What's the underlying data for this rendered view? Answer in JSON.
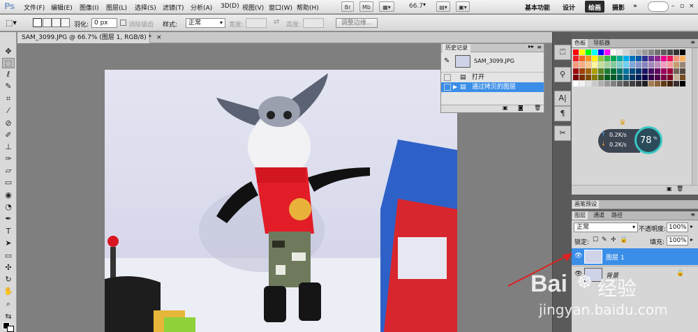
{
  "menubar": {
    "logo": "Ps",
    "items": [
      "文件(F)",
      "编辑(E)",
      "图像(I)",
      "图层(L)",
      "选择(S)",
      "滤镜(T)",
      "分析(A)",
      "3D(D)",
      "视图(V)",
      "窗口(W)",
      "帮助(H)"
    ],
    "app_buttons": [
      "Br",
      "Mb"
    ],
    "zoom": "66.7",
    "workspaces": [
      "基本功能",
      "设计",
      "绘画",
      "摄影"
    ],
    "active_workspace": "绘画",
    "more": "»"
  },
  "options": {
    "feather_label": "羽化:",
    "feather_value": "0 px",
    "antialias_label": "消除锯齿",
    "style_label": "样式:",
    "style_value": "正常",
    "width_label": "宽度:",
    "height_label": "高度:",
    "refine_button": "调整边缘..."
  },
  "document": {
    "tab_title": "SAM_3099.JPG @ 66.7% (图层 1, RGB/8) *",
    "close": "×"
  },
  "history": {
    "tab": "历史记录",
    "snapshot": "SAM_3099.JPG",
    "items": [
      {
        "label": "打开",
        "selected": false
      },
      {
        "label": "通过拷贝的图层",
        "selected": true
      }
    ]
  },
  "swatches": {
    "tabs": [
      "色板",
      "导航器"
    ],
    "colors": [
      "#ff0000",
      "#ffff00",
      "#00ff00",
      "#00ffff",
      "#0000ff",
      "#ff00ff",
      "#ffffff",
      "#ebebeb",
      "#d6d6d6",
      "#c2c2c2",
      "#adadad",
      "#999999",
      "#858585",
      "#707070",
      "#5c5c5c",
      "#474747",
      "#333333",
      "#000000",
      "#ee1d24",
      "#f26522",
      "#f7941d",
      "#fff200",
      "#8dc63f",
      "#39b54a",
      "#00a651",
      "#00a99d",
      "#00aeef",
      "#0072bc",
      "#0054a6",
      "#2e3192",
      "#662d91",
      "#92278f",
      "#ec008c",
      "#ed145b",
      "#f69679",
      "#fbaf5d",
      "#f7977a",
      "#f9ad81",
      "#fdc68a",
      "#fff79a",
      "#c4df9b",
      "#a3d39c",
      "#82ca9d",
      "#7bcdc8",
      "#6ecff6",
      "#7ea7d8",
      "#8493ca",
      "#8882be",
      "#a187be",
      "#bc8dbf",
      "#f49ac2",
      "#f6989d",
      "#c69c6d",
      "#998675",
      "#9e0b0f",
      "#a0410d",
      "#a3620a",
      "#aba000",
      "#598527",
      "#1a7b30",
      "#007236",
      "#00746b",
      "#0076a3",
      "#004b80",
      "#003471",
      "#1b1464",
      "#440e62",
      "#630460",
      "#9e005d",
      "#9e0039",
      "#736357",
      "#534741",
      "#790000",
      "#7b2e00",
      "#7d4900",
      "#827b00",
      "#406618",
      "#005e20",
      "#005826",
      "#005952",
      "#005b7f",
      "#003663",
      "#002157",
      "#0d004c",
      "#32004b",
      "#4b0049",
      "#7b0046",
      "#7a0026",
      "#c7b299",
      "#754c24",
      "#ffffff",
      "#f2f2f2",
      "#e0e0e0",
      "#c8c8c8",
      "#b0b0b0",
      "#989898",
      "#808080",
      "#686868",
      "#505050",
      "#404040",
      "#303030",
      "#202020",
      "#a67c52",
      "#8c6239",
      "#603913",
      "#42210b",
      "#362f2d",
      "#000000"
    ]
  },
  "network": {
    "up": "0.2K/s",
    "down": "0.2K/s",
    "percent": "78",
    "unit": "%"
  },
  "brush_presets": {
    "tab": "画笔预设"
  },
  "layers": {
    "tabs": [
      "图层",
      "通道",
      "路径"
    ],
    "blend_mode": "正常",
    "opacity_label": "不透明度:",
    "opacity_value": "100%",
    "lock_label": "锁定:",
    "fill_label": "填充:",
    "fill_value": "100%",
    "rows": [
      {
        "name": "图层 1",
        "selected": true,
        "visible": true,
        "locked": false
      },
      {
        "name": "背景",
        "selected": false,
        "visible": true,
        "locked": true
      }
    ]
  },
  "watermark": {
    "brand": "Bai",
    "brand_tail": "经验",
    "url": "jingyan.baidu.com"
  },
  "colors": {
    "accent_blue": "#3b8ee8",
    "arrow_red": "#e02020"
  }
}
